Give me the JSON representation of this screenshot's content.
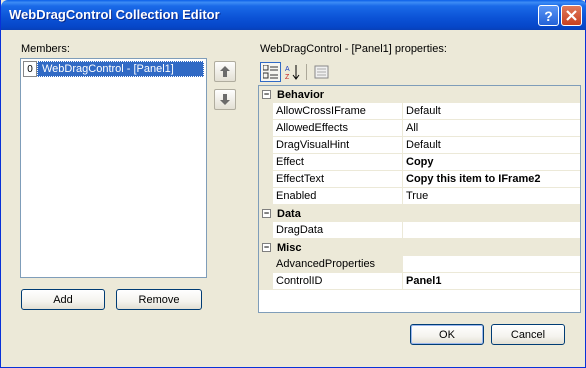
{
  "window": {
    "title": "WebDragControl Collection Editor",
    "help_icon": "question-mark",
    "close_icon": "x"
  },
  "members": {
    "label": "Members:",
    "items": [
      {
        "index": "0",
        "text": "WebDragControl - [Panel1]"
      }
    ],
    "move_up_icon": "arrow-up",
    "move_down_icon": "arrow-down",
    "add_label": "Add",
    "remove_label": "Remove"
  },
  "properties": {
    "label": "WebDragControl - [Panel1] properties:",
    "toolbar": {
      "categorized_icon": "categorized-icon",
      "alphabetical_icon": "alphabetical-icon",
      "property_pages_icon": "property-pages-icon"
    },
    "categories": [
      {
        "name": "Behavior",
        "toggle": "−",
        "rows": [
          {
            "name": "AllowCrossIFrame",
            "value": "Default",
            "bold": false
          },
          {
            "name": "AllowedEffects",
            "value": "All",
            "bold": false
          },
          {
            "name": "DragVisualHint",
            "value": "Default",
            "bold": false
          },
          {
            "name": "Effect",
            "value": "Copy",
            "bold": true
          },
          {
            "name": "EffectText",
            "value": "Copy this item to IFrame2",
            "bold": true
          },
          {
            "name": "Enabled",
            "value": "True",
            "bold": false
          }
        ]
      },
      {
        "name": "Data",
        "toggle": "−",
        "rows": [
          {
            "name": "DragData",
            "value": "",
            "bold": false
          }
        ]
      },
      {
        "name": "Misc",
        "toggle": "−",
        "rows": [
          {
            "name": "AdvancedProperties",
            "value": "",
            "bold": false,
            "greyed": true
          },
          {
            "name": "ControlID",
            "value": "Panel1",
            "bold": true
          }
        ]
      }
    ]
  },
  "footer": {
    "ok_label": "OK",
    "cancel_label": "Cancel"
  }
}
